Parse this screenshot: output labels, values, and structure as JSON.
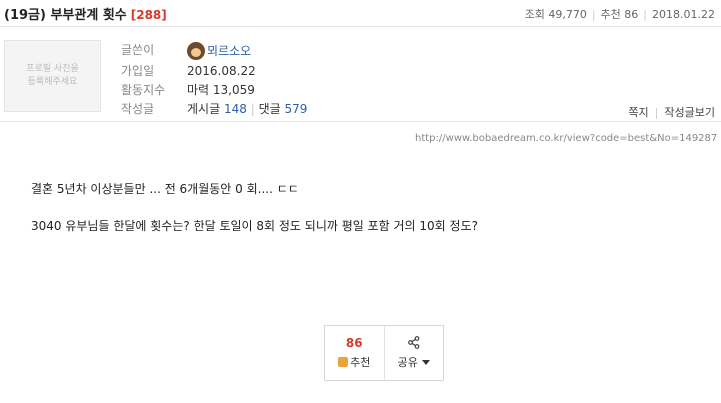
{
  "post": {
    "title": "(19금) 부부관계 횟수",
    "comment_count": "[288]",
    "views_label": "조회",
    "views": "49,770",
    "recommend_label": "추천",
    "recommend": "86",
    "date": "2018.01.22"
  },
  "profile": {
    "placeholder": "프로필 사진을 등록해주세요"
  },
  "author": {
    "writer_label": "글쓴이",
    "nickname": "뫼르소오",
    "joined_label": "가입일",
    "joined": "2016.08.22",
    "activity_label": "활동지수",
    "activity": "마력 13,059",
    "posts_label": "작성글",
    "posts_text": "게시글",
    "posts_count": "148",
    "comments_text": "댓글",
    "comments_count": "579"
  },
  "actions": {
    "message": "쪽지",
    "view_posts": "작성글보기"
  },
  "source_url": "http://www.bobaedream.co.kr/view?code=best&No=149287",
  "content": {
    "line1": "결혼 5년차 이상분들만 ... 전 6개월동안 0 회.... ㄷㄷ",
    "line2": "3040 유부님들 한달에 횟수는? 한달 토일이 8회 정도 되니까 평일 포함 거의 10회 정도?"
  },
  "vote": {
    "count": "86",
    "recommend_label": "추천",
    "share_label": "공유"
  },
  "icons": {
    "avatar": "avatar-icon",
    "thumb": "thumbs-up-icon",
    "share": "share-icon",
    "caret": "caret-down-icon"
  },
  "colors": {
    "accent_red": "#d9392a",
    "link_blue": "#2a5fa6",
    "thumb_orange": "#e8a33a"
  }
}
